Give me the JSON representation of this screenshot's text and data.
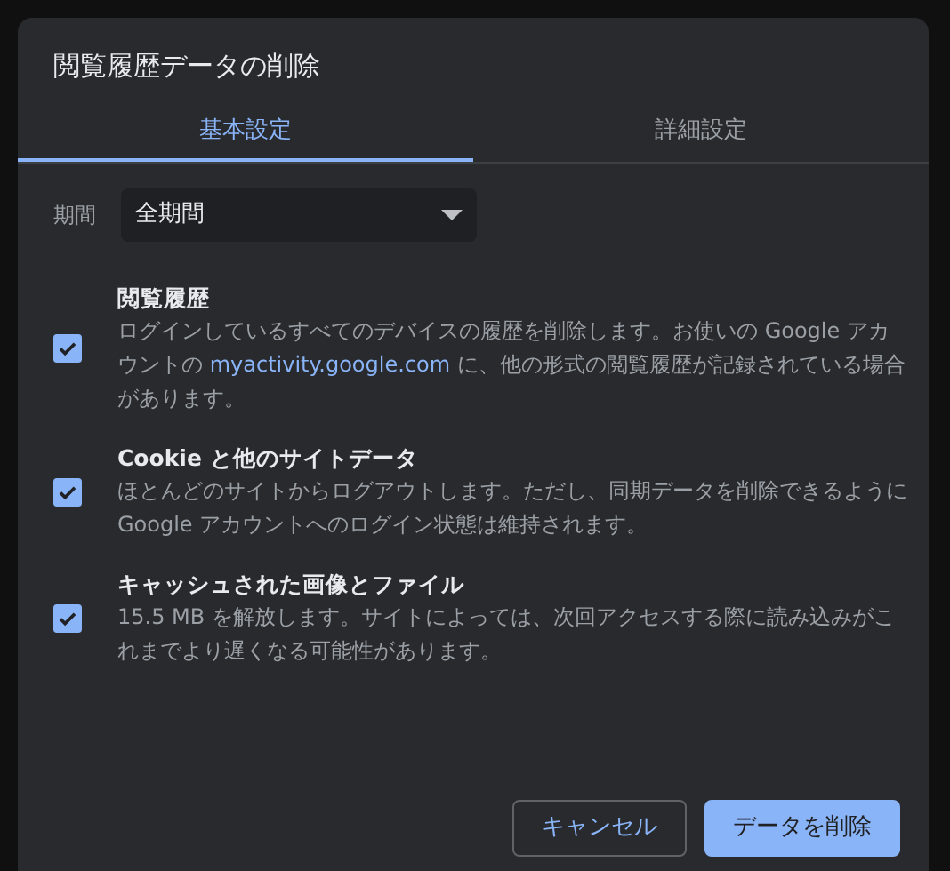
{
  "dialog": {
    "title": "閲覧履歴データの削除"
  },
  "tabs": [
    {
      "label": "基本設定",
      "selected": true
    },
    {
      "label": "詳細設定",
      "selected": false
    }
  ],
  "period": {
    "label": "期間",
    "value": "全期間"
  },
  "items": [
    {
      "title": "閲覧履歴",
      "checked": true,
      "description": [
        {
          "kind": "text",
          "text": "ログインしているすべてのデバイスの履歴を削除します。お使いの Google アカウントの "
        },
        {
          "kind": "link",
          "text": "myactivity.google.com"
        },
        {
          "kind": "text",
          "text": " に、他の形式の閲覧履歴が記録されている場合があります。"
        }
      ]
    },
    {
      "title": "Cookie と他のサイトデータ",
      "checked": true,
      "description": [
        {
          "kind": "text",
          "text": "ほとんどのサイトからログアウトします。ただし、同期データを削除できるように Google アカウントへのログイン状態は維持されます。"
        }
      ]
    },
    {
      "title": "キャッシュされた画像とファイル",
      "checked": true,
      "description": [
        {
          "kind": "text",
          "text": "15.5 MB を解放します。サイトによっては、次回アクセスする際に読み込みがこれまでより遅くなる可能性があります。"
        }
      ]
    }
  ],
  "buttons": [
    {
      "label": "キャンセル",
      "kind": "secondary"
    },
    {
      "label": "データを削除",
      "kind": "primary"
    }
  ]
}
